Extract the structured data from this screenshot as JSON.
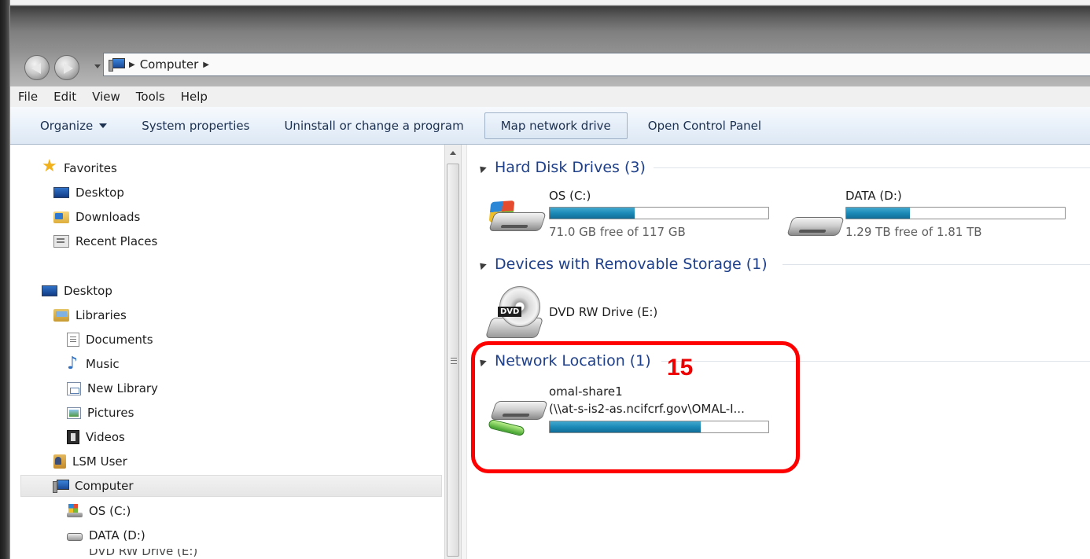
{
  "window": {
    "address_path": [
      "Computer"
    ]
  },
  "menu": {
    "items": [
      "File",
      "Edit",
      "View",
      "Tools",
      "Help"
    ]
  },
  "toolbar": {
    "organize": "Organize",
    "system_properties": "System properties",
    "uninstall": "Uninstall or change a program",
    "map_network_drive": "Map network drive",
    "open_control_panel": "Open Control Panel"
  },
  "nav": {
    "favorites": "Favorites",
    "fav_desktop": "Desktop",
    "fav_downloads": "Downloads",
    "fav_recent": "Recent Places",
    "desktop": "Desktop",
    "libraries": "Libraries",
    "documents": "Documents",
    "music": "Music",
    "new_library": "New Library",
    "pictures": "Pictures",
    "videos": "Videos",
    "lsm_user": "LSM User",
    "computer": "Computer",
    "os_c": "OS (C:)",
    "data_d": "DATA (D:)",
    "dvd_e": "DVD RW Drive (E:)"
  },
  "content": {
    "hard_disk_header": "Hard Disk Drives (3)",
    "removable_header": "Devices with Removable Storage (1)",
    "network_header": "Network Location (1)",
    "drives": {
      "os": {
        "name": "OS (C:)",
        "free_text": "71.0 GB free of 117 GB",
        "used_fraction": 0.39
      },
      "data": {
        "name": "DATA (D:)",
        "free_text": "1.29 TB free of 1.81 TB",
        "used_fraction": 0.29
      },
      "dvd": {
        "name": "DVD RW Drive (E:)",
        "disc_label": "DVD"
      },
      "network": {
        "name": "omal-share1",
        "path": "(\\\\at-s-is2-as.ncifcrf.gov\\OMAL-I...",
        "used_fraction": 0.69
      }
    }
  },
  "annotation": {
    "number": "15",
    "color": "#ff0000"
  }
}
